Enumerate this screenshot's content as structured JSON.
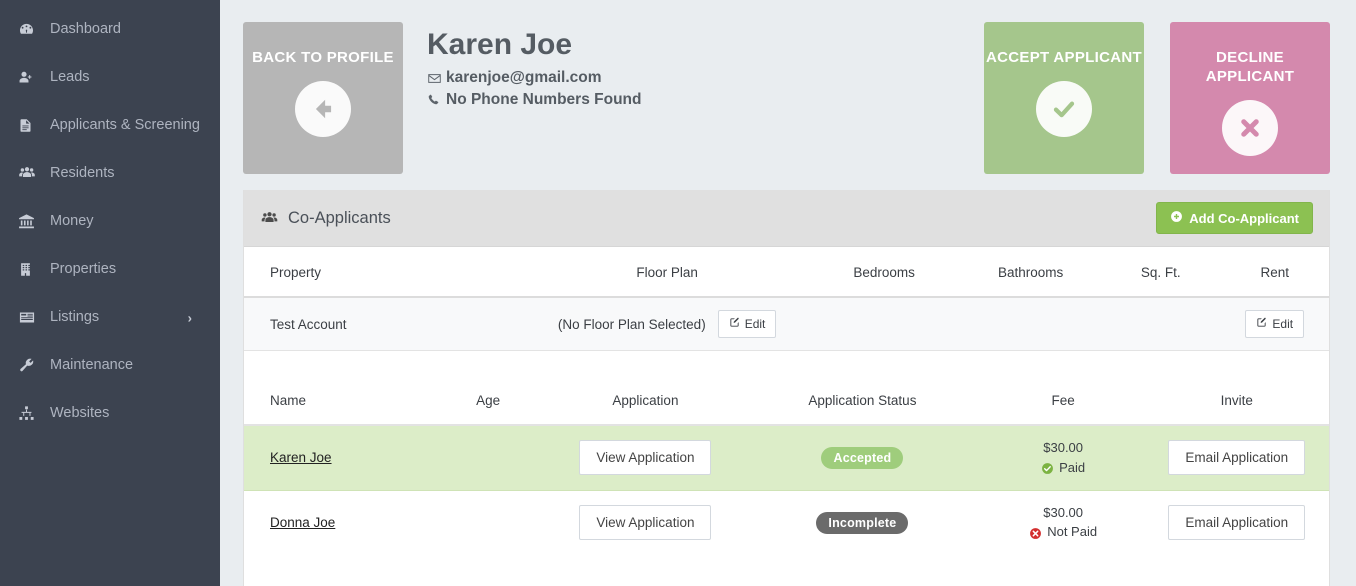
{
  "sidebar": {
    "items": [
      {
        "label": "Dashboard",
        "icon": "dashboard-icon",
        "has_chevron": false
      },
      {
        "label": "Leads",
        "icon": "user-plus-icon",
        "has_chevron": false
      },
      {
        "label": "Applicants & Screening",
        "icon": "document-icon",
        "has_chevron": false
      },
      {
        "label": "Residents",
        "icon": "users-icon",
        "has_chevron": false
      },
      {
        "label": "Money",
        "icon": "bank-icon",
        "has_chevron": false
      },
      {
        "label": "Properties",
        "icon": "building-icon",
        "has_chevron": false
      },
      {
        "label": "Listings",
        "icon": "list-icon",
        "has_chevron": true
      },
      {
        "label": "Maintenance",
        "icon": "wrench-icon",
        "has_chevron": false
      },
      {
        "label": "Websites",
        "icon": "sitemap-icon",
        "has_chevron": false
      }
    ],
    "chevron_glyph": "›",
    "background_color": "#3c4350",
    "text_color": "#aeb4c0"
  },
  "header": {
    "back_tile": {
      "label": "BACK TO PROFILE",
      "icon": "arrow-left-circle-icon",
      "color": "#b6b6b6"
    },
    "accept_tile": {
      "label": "ACCEPT APPLICANT",
      "icon": "check-circle-icon",
      "color": "#a5c68c"
    },
    "decline_tile": {
      "label": "DECLINE APPLICANT",
      "icon": "times-circle-icon",
      "color": "#d489ad"
    },
    "applicant_name": "Karen Joe",
    "email": "karenjoe@gmail.com",
    "email_icon": "envelope-icon",
    "phone": "No Phone Numbers Found",
    "phone_icon": "phone-icon"
  },
  "panel": {
    "title": "Co-Applicants",
    "title_icon": "users-icon",
    "add_button": {
      "label": "Add Co-Applicant",
      "icon": "plus-circle-icon",
      "color": "#8cc152"
    }
  },
  "property_table": {
    "columns": [
      "Property",
      "Floor Plan",
      "Bedrooms",
      "Bathrooms",
      "Sq. Ft.",
      "Rent"
    ],
    "rows": [
      {
        "property": "Test Account",
        "floor_plan": "(No Floor Plan Selected)",
        "floor_plan_edit": "Edit",
        "bedrooms": "",
        "bathrooms": "",
        "sqft": "",
        "rent_edit": "Edit"
      }
    ],
    "edit_icon": "edit-pencil-icon"
  },
  "applicants_table": {
    "columns": [
      "Name",
      "Age",
      "Application",
      "Application Status",
      "Fee",
      "Invite"
    ],
    "rows": [
      {
        "name": "Karen Joe",
        "age": "",
        "application_button": "View Application",
        "status": "Accepted",
        "status_kind": "accepted",
        "status_color": "#9fcd7c",
        "fee_amount": "$30.00",
        "fee_status": "Paid",
        "fee_status_kind": "paid",
        "fee_status_color": "#7cb342",
        "invite_button": "Email Application",
        "highlighted": true,
        "row_color": "#dcedc8"
      },
      {
        "name": "Donna Joe",
        "age": "",
        "application_button": "View Application",
        "status": "Incomplete",
        "status_kind": "incomplete",
        "status_color": "#6b6b6b",
        "fee_amount": "$30.00",
        "fee_status": "Not Paid",
        "fee_status_kind": "not-paid",
        "fee_status_color": "#d32f2f",
        "invite_button": "Email Application",
        "highlighted": false,
        "row_color": "#ffffff"
      }
    ]
  }
}
